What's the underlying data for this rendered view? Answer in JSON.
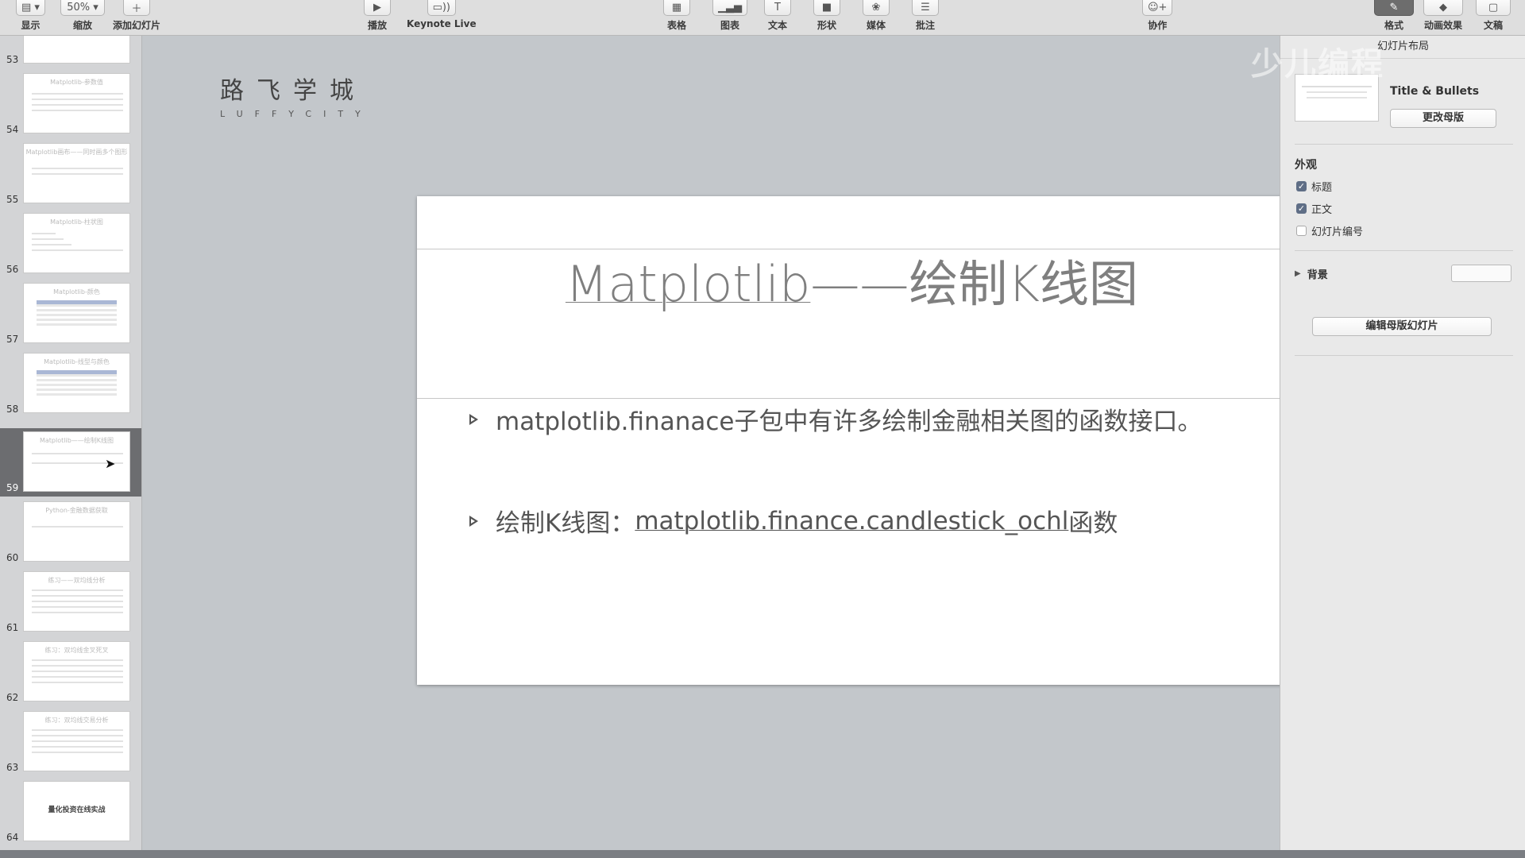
{
  "toolbar": {
    "view": {
      "label": "显示",
      "icon": "sidebar-icon"
    },
    "zoom": {
      "label": "缩放",
      "value": "50%"
    },
    "add_slide": {
      "label": "添加幻灯片",
      "icon": "plus-icon"
    },
    "play": {
      "label": "播放",
      "icon": "play-icon"
    },
    "keynote_live": {
      "label": "Keynote Live",
      "icon": "broadcast-icon"
    },
    "table": {
      "label": "表格",
      "icon": "table-icon"
    },
    "chart": {
      "label": "图表",
      "icon": "chart-icon"
    },
    "text": {
      "label": "文本",
      "icon": "text-icon"
    },
    "shape": {
      "label": "形状",
      "icon": "shape-icon"
    },
    "media": {
      "label": "媒体",
      "icon": "media-icon"
    },
    "comment": {
      "label": "批注",
      "icon": "comment-icon"
    },
    "collaborate": {
      "label": "协作",
      "icon": "collaborate-icon"
    },
    "format": {
      "label": "格式",
      "icon": "paintbrush-icon"
    },
    "animate": {
      "label": "动画效果",
      "icon": "diamond-icon"
    },
    "document": {
      "label": "文稿",
      "icon": "document-icon"
    }
  },
  "navigator": {
    "selected": "59",
    "slides": [
      {
        "num": "53",
        "title": ""
      },
      {
        "num": "54",
        "title": "Matplotlib-参数值"
      },
      {
        "num": "55",
        "title": "Matplotlib画布——同时画多个图形"
      },
      {
        "num": "56",
        "title": "Matplotlib-柱状图"
      },
      {
        "num": "57",
        "title": "Matplotlib-颜色"
      },
      {
        "num": "58",
        "title": "Matplotlib-线型与颜色"
      },
      {
        "num": "59",
        "title": "Matplotlib——绘制K线图"
      },
      {
        "num": "60",
        "title": "Python-金融数据获取"
      },
      {
        "num": "61",
        "title": "练习——双均线分析"
      },
      {
        "num": "62",
        "title": "练习：双均线金叉死叉"
      },
      {
        "num": "63",
        "title": "练习：双均线交易分析"
      },
      {
        "num": "64",
        "title": "",
        "center_text": "量化投资在线实战"
      }
    ]
  },
  "logo": {
    "cn": "路飞学城",
    "en": "LUFFYCITY"
  },
  "slide": {
    "title_part1": "Matplotlib",
    "title_part2": "——绘制K线图",
    "bullet1": "matplotlib.finanace子包中有许多绘制金融相关图的函数接口。",
    "bullet2_prefix": "绘制K线图：",
    "bullet2_link": "matplotlib.finance.candlestick_ochl",
    "bullet2_suffix": "函数"
  },
  "inspector": {
    "header": "幻灯片布局",
    "master_name": "Title & Bullets",
    "change_master": "更改母版",
    "appearance": "外观",
    "title_checkbox": {
      "label": "标题",
      "checked": true
    },
    "body_checkbox": {
      "label": "正文",
      "checked": true
    },
    "slide_number_checkbox": {
      "label": "幻灯片编号",
      "checked": false
    },
    "background": "背景",
    "edit_master": "编辑母版幻灯片"
  },
  "watermark": "少儿编程"
}
